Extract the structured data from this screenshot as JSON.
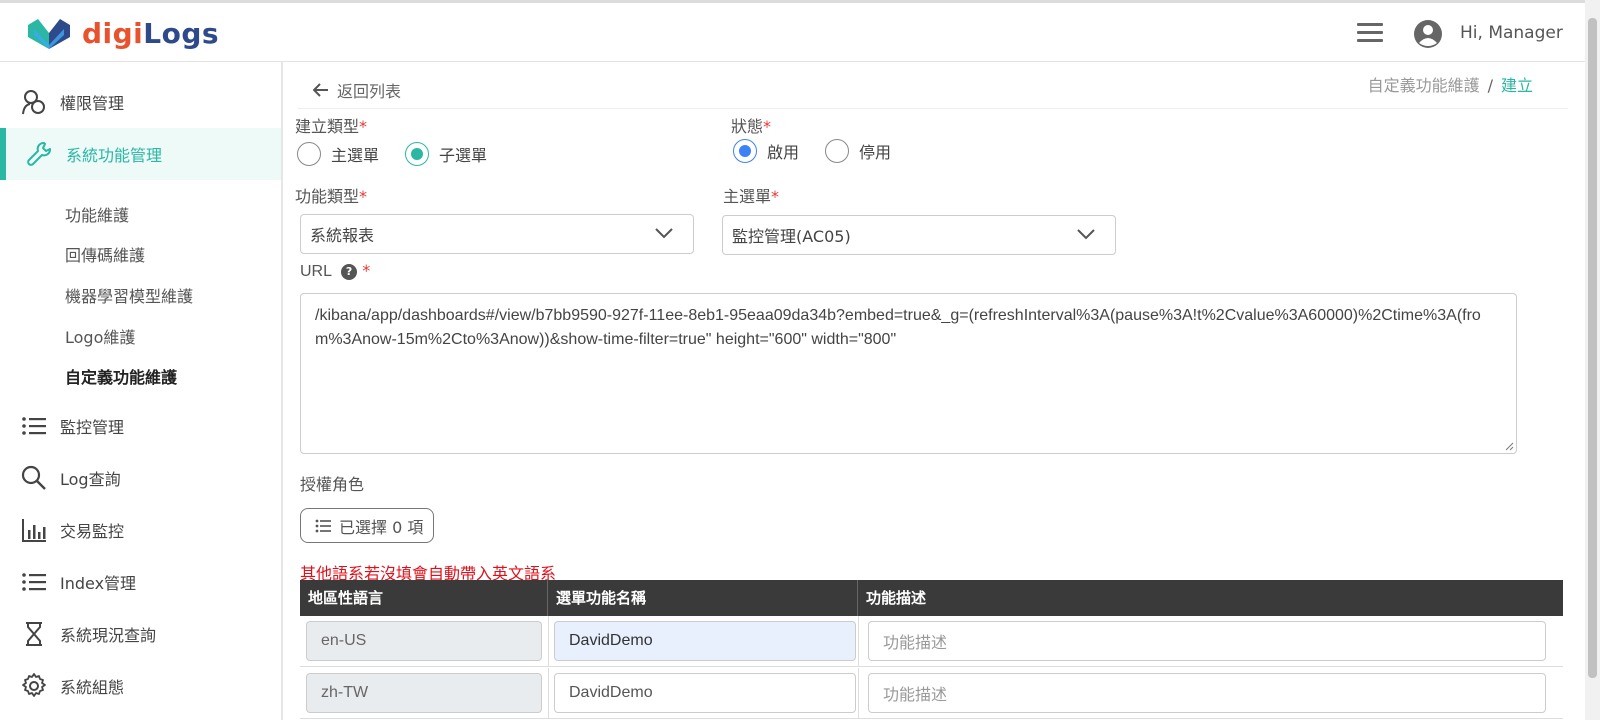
{
  "header": {
    "logo_part1": "digi",
    "logo_part2": "Logs",
    "greeting": "Hi, Manager",
    "accent_color": "#2ab7a4"
  },
  "sidebar": {
    "items": [
      {
        "label": "權限管理",
        "icon": "users-icon"
      },
      {
        "label": "系統功能管理",
        "icon": "wrench-icon",
        "active": true
      },
      {
        "label": "監控管理",
        "icon": "list-icon"
      },
      {
        "label": "Log查詢",
        "icon": "search-icon"
      },
      {
        "label": "交易監控",
        "icon": "bar-chart-icon"
      },
      {
        "label": "Index管理",
        "icon": "list-icon"
      },
      {
        "label": "系統現況查詢",
        "icon": "hourglass-icon"
      },
      {
        "label": "系統組態",
        "icon": "gear-icon"
      }
    ],
    "subitems": [
      {
        "label": "功能維護"
      },
      {
        "label": "回傳碼維護"
      },
      {
        "label": "機器學習模型維護"
      },
      {
        "label": "Logo維護"
      },
      {
        "label": "自定義功能維護",
        "current": true
      }
    ]
  },
  "main": {
    "back_label": "返回列表",
    "breadcrumb": {
      "parent": "自定義功能維護",
      "separator": "/",
      "current": "建立"
    },
    "create_type": {
      "label": "建立類型",
      "options": [
        "主選單",
        "子選單"
      ],
      "selected": "子選單"
    },
    "status": {
      "label": "狀態",
      "options": [
        "啟用",
        "停用"
      ],
      "selected": "啟用"
    },
    "function_type": {
      "label": "功能類型",
      "value": "系統報表"
    },
    "main_menu": {
      "label": "主選單",
      "value": "監控管理(AC05)"
    },
    "url": {
      "label": "URL",
      "help": "?",
      "value": "/kibana/app/dashboards#/view/b7bb9590-927f-11ee-8eb1-95eaa09da34b?embed=true&_g=(refreshInterval%3A(pause%3A!t%2Cvalue%3A60000)%2Ctime%3A(from%3Anow-15m%2Cto%3Anow))&show-time-filter=true\" height=\"600\" width=\"800\""
    },
    "roles": {
      "label": "授權角色",
      "button": "已選擇 0 項"
    },
    "warning": "其他語系若沒填會自動帶入英文語系",
    "required_mark": "*",
    "table": {
      "headers": [
        "地區性語言",
        "選單功能名稱",
        "功能描述"
      ],
      "rows": [
        {
          "locale": "en-US",
          "name": "DavidDemo",
          "desc_placeholder": "功能描述"
        },
        {
          "locale": "zh-TW",
          "name": "DavidDemo",
          "desc_placeholder": "功能描述"
        }
      ]
    }
  }
}
